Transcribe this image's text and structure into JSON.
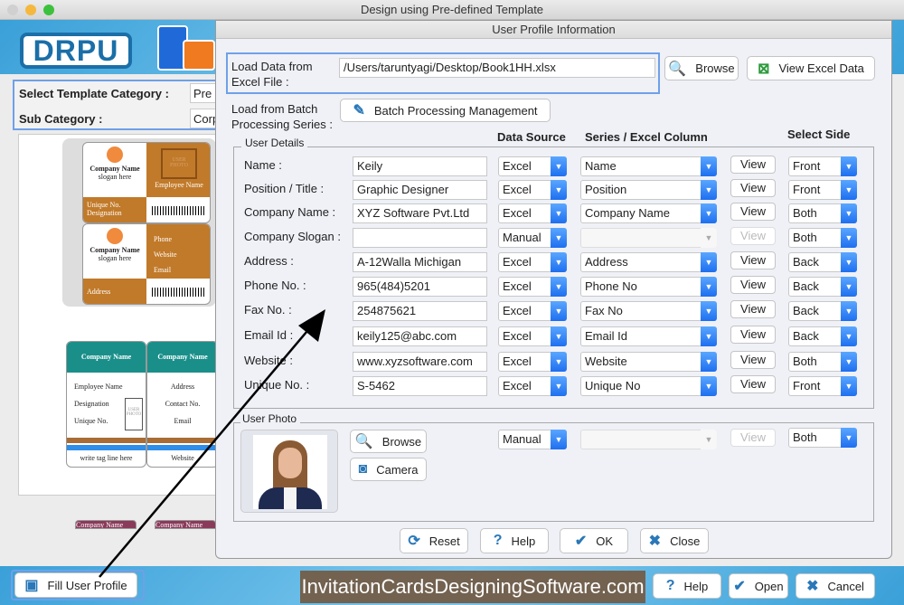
{
  "window": {
    "title": "Design using Pre-defined Template"
  },
  "brand": {
    "logo": "DRPU"
  },
  "category": {
    "label": "Select Template Category :",
    "value": "Pre",
    "sub_label": "Sub Category :",
    "sub_value": "Corp"
  },
  "templates": {
    "card1_company": "Company Name",
    "card1_slogan": "slogan here",
    "card1_photo": "USER PHOTO",
    "card1_emp": "Employee Name",
    "card1_unique": "Unique No. Designation",
    "card2_phone": "Phone",
    "card2_web": "Website",
    "card2_email": "Email",
    "card2_address": "Address",
    "card3_company": "Company Name",
    "card3_emp": "Employee Name",
    "card3_desig": "Designation",
    "card3_unique": "Unique No.",
    "card3_photo": "USER PHOTO",
    "card3_tag": "write tag line here",
    "card4_company": "Company Name",
    "card4_address": "Address",
    "card4_contact": "Contact No.",
    "card4_email": "Email",
    "card4_web": "Website",
    "card5_company": "Company Name",
    "card6_company": "Company Name"
  },
  "dialog": {
    "title": "User Profile Information",
    "load_excel_label": "Load Data from Excel File :",
    "excel_path": "/Users/taruntyagi/Desktop/Book1HH.xlsx",
    "browse": "Browse",
    "view_excel": "View Excel Data",
    "batch_label": "Load from Batch Processing Series :",
    "batch_button": "Batch Processing Management",
    "user_details": "User Details",
    "col_source": "Data Source",
    "col_series": "Series / Excel Column",
    "col_side": "Select Side",
    "view": "View",
    "rows": [
      {
        "label": "Name :",
        "value": "Keily",
        "source": "Excel",
        "column": "Name",
        "side": "Front"
      },
      {
        "label": "Position / Title :",
        "value": "Graphic Designer",
        "source": "Excel",
        "column": "Position",
        "side": "Front"
      },
      {
        "label": "Company Name :",
        "value": "XYZ Software Pvt.Ltd",
        "source": "Excel",
        "column": "Company Name",
        "side": "Both"
      },
      {
        "label": "Company Slogan :",
        "value": "",
        "source": "Manual",
        "column": "",
        "side": "Both"
      },
      {
        "label": "Address :",
        "value": "A-12Walla Michigan",
        "source": "Excel",
        "column": "Address",
        "side": "Back"
      },
      {
        "label": "Phone No. :",
        "value": "965(484)5201",
        "source": "Excel",
        "column": "Phone No",
        "side": "Back"
      },
      {
        "label": "Fax No. :",
        "value": "254875621",
        "source": "Excel",
        "column": "Fax No",
        "side": "Back"
      },
      {
        "label": "Email Id :",
        "value": "keily125@abc.com",
        "source": "Excel",
        "column": "Email Id",
        "side": "Back"
      },
      {
        "label": "Website :",
        "value": "www.xyzsoftware.com",
        "source": "Excel",
        "column": "Website",
        "side": "Both"
      },
      {
        "label": "Unique No. :",
        "value": "S-5462",
        "source": "Excel",
        "column": "Unique No",
        "side": "Front"
      }
    ],
    "user_photo": "User Photo",
    "photo_browse": "Browse",
    "camera": "Camera",
    "photo_source": "Manual",
    "photo_side": "Both",
    "reset": "Reset",
    "help": "Help",
    "ok": "OK",
    "close": "Close"
  },
  "footer": {
    "fill_profile": "Fill User Profile",
    "website": "InvitationCardsDesigningSoftware.com",
    "help": "Help",
    "open": "Open",
    "cancel": "Cancel"
  },
  "colors": {
    "accent": "#1e6ff0",
    "brand": "#1b6fa8",
    "card_orange": "#c17a2a",
    "card_teal": "#1a8f8a",
    "footer_banner": "#736250"
  }
}
